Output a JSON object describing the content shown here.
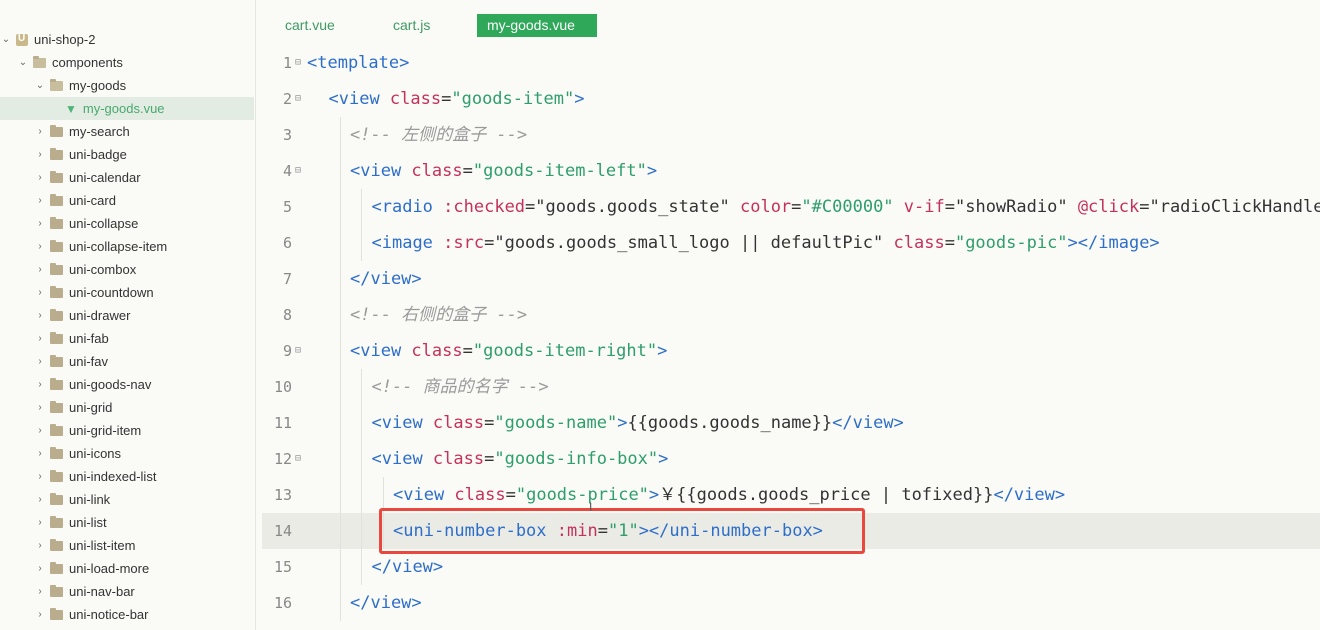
{
  "sidebar": {
    "project": "uni-shop-2",
    "items": [
      {
        "label": "components",
        "open": true,
        "depth": 1
      },
      {
        "label": "my-goods",
        "open": true,
        "depth": 2
      },
      {
        "label": "my-goods.vue",
        "file": true,
        "depth": 3,
        "active": true
      },
      {
        "label": "my-search",
        "depth": 2
      },
      {
        "label": "uni-badge",
        "depth": 2
      },
      {
        "label": "uni-calendar",
        "depth": 2
      },
      {
        "label": "uni-card",
        "depth": 2
      },
      {
        "label": "uni-collapse",
        "depth": 2
      },
      {
        "label": "uni-collapse-item",
        "depth": 2
      },
      {
        "label": "uni-combox",
        "depth": 2
      },
      {
        "label": "uni-countdown",
        "depth": 2
      },
      {
        "label": "uni-drawer",
        "depth": 2
      },
      {
        "label": "uni-fab",
        "depth": 2
      },
      {
        "label": "uni-fav",
        "depth": 2
      },
      {
        "label": "uni-goods-nav",
        "depth": 2
      },
      {
        "label": "uni-grid",
        "depth": 2
      },
      {
        "label": "uni-grid-item",
        "depth": 2
      },
      {
        "label": "uni-icons",
        "depth": 2
      },
      {
        "label": "uni-indexed-list",
        "depth": 2
      },
      {
        "label": "uni-link",
        "depth": 2
      },
      {
        "label": "uni-list",
        "depth": 2
      },
      {
        "label": "uni-list-item",
        "depth": 2
      },
      {
        "label": "uni-load-more",
        "depth": 2
      },
      {
        "label": "uni-nav-bar",
        "depth": 2
      },
      {
        "label": "uni-notice-bar",
        "depth": 2
      }
    ]
  },
  "tabs": [
    {
      "label": "cart.vue"
    },
    {
      "label": "cart.js"
    },
    {
      "label": "my-goods.vue",
      "active": true
    }
  ],
  "editor": {
    "current_line": 14,
    "lines": [
      {
        "n": "1",
        "fold": true,
        "indent": 0,
        "tokens": [
          [
            "tag",
            "<template>"
          ]
        ]
      },
      {
        "n": "2",
        "fold": true,
        "indent": 1,
        "tokens": [
          [
            "tag",
            "<view "
          ],
          [
            "attr",
            "class"
          ],
          [
            "plain",
            "="
          ],
          [
            "str",
            "\"goods-item\""
          ],
          [
            "tag",
            ">"
          ]
        ]
      },
      {
        "n": "3",
        "indent": 2,
        "tokens": [
          [
            "cmt",
            "<!-- 左侧的盒子 -->"
          ]
        ]
      },
      {
        "n": "4",
        "fold": true,
        "indent": 2,
        "tokens": [
          [
            "tag",
            "<view "
          ],
          [
            "attr",
            "class"
          ],
          [
            "plain",
            "="
          ],
          [
            "str",
            "\"goods-item-left\""
          ],
          [
            "tag",
            ">"
          ]
        ]
      },
      {
        "n": "5",
        "indent": 3,
        "tokens": [
          [
            "tag",
            "<radio "
          ],
          [
            "attr",
            ":checked"
          ],
          [
            "plain",
            "=\"goods.goods_state\" "
          ],
          [
            "attr",
            "color"
          ],
          [
            "plain",
            "="
          ],
          [
            "str",
            "\"#C00000\""
          ],
          [
            "plain",
            " "
          ],
          [
            "attr",
            "v-if"
          ],
          [
            "plain",
            "=\"showRadio\" "
          ],
          [
            "attr",
            "@click"
          ],
          [
            "plain",
            "=\"radioClickHandler\""
          ]
        ]
      },
      {
        "n": "6",
        "indent": 3,
        "tokens": [
          [
            "tag",
            "<image "
          ],
          [
            "attr",
            ":src"
          ],
          [
            "plain",
            "=\"goods.goods_small_logo || defaultPic\" "
          ],
          [
            "attr",
            "class"
          ],
          [
            "plain",
            "="
          ],
          [
            "str",
            "\"goods-pic\""
          ],
          [
            "tag",
            "></image>"
          ]
        ]
      },
      {
        "n": "7",
        "indent": 2,
        "tokens": [
          [
            "tag",
            "</view>"
          ]
        ]
      },
      {
        "n": "8",
        "indent": 2,
        "tokens": [
          [
            "cmt",
            "<!-- 右侧的盒子 -->"
          ]
        ]
      },
      {
        "n": "9",
        "fold": true,
        "indent": 2,
        "tokens": [
          [
            "tag",
            "<view "
          ],
          [
            "attr",
            "class"
          ],
          [
            "plain",
            "="
          ],
          [
            "str",
            "\"goods-item-right\""
          ],
          [
            "tag",
            ">"
          ]
        ]
      },
      {
        "n": "10",
        "indent": 3,
        "tokens": [
          [
            "cmt",
            "<!-- 商品的名字 -->"
          ]
        ]
      },
      {
        "n": "11",
        "indent": 3,
        "tokens": [
          [
            "tag",
            "<view "
          ],
          [
            "attr",
            "class"
          ],
          [
            "plain",
            "="
          ],
          [
            "str",
            "\"goods-name\""
          ],
          [
            "tag",
            ">"
          ],
          [
            "plain",
            "{{goods.goods_name}}"
          ],
          [
            "tag",
            "</view>"
          ]
        ]
      },
      {
        "n": "12",
        "fold": true,
        "indent": 3,
        "tokens": [
          [
            "tag",
            "<view "
          ],
          [
            "attr",
            "class"
          ],
          [
            "plain",
            "="
          ],
          [
            "str",
            "\"goods-info-box\""
          ],
          [
            "tag",
            ">"
          ]
        ]
      },
      {
        "n": "13",
        "indent": 4,
        "tokens": [
          [
            "tag",
            "<view "
          ],
          [
            "attr",
            "class"
          ],
          [
            "plain",
            "="
          ],
          [
            "str",
            "\"goods-price\""
          ],
          [
            "tag",
            ">"
          ],
          [
            "plain",
            "￥{{goods.goods_price | tofixed}}"
          ],
          [
            "tag",
            "</view>"
          ]
        ]
      },
      {
        "n": "14",
        "indent": 4,
        "tokens": [
          [
            "tag",
            "<uni-number-box "
          ],
          [
            "attr",
            ":min"
          ],
          [
            "plain",
            "="
          ],
          [
            "str",
            "\"1\""
          ],
          [
            "tag",
            "></uni-number-box>"
          ]
        ]
      },
      {
        "n": "15",
        "indent": 3,
        "tokens": [
          [
            "tag",
            "</view>"
          ]
        ]
      },
      {
        "n": "16",
        "indent": 2,
        "tokens": [
          [
            "tag",
            "</view>"
          ]
        ]
      }
    ]
  }
}
